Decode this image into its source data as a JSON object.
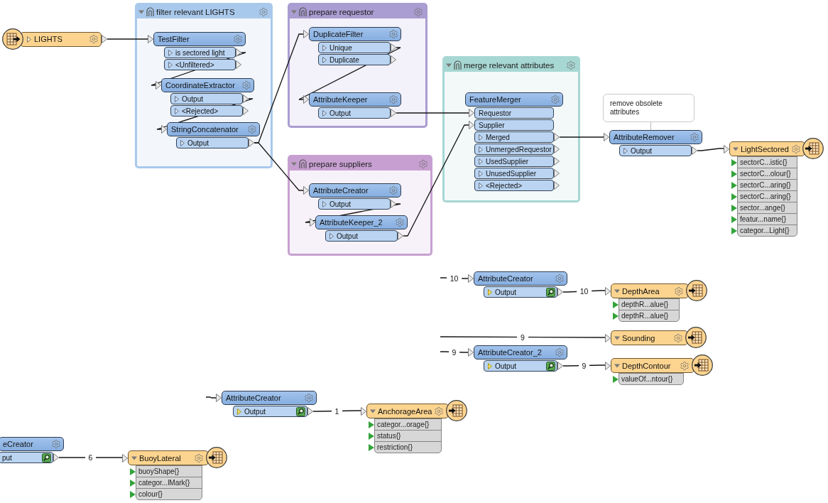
{
  "canvas": {
    "readers": [
      {
        "name": "LIGHTS",
        "expanded": false
      }
    ],
    "bookmarks": [
      {
        "title": "filter relevant LIGHTS",
        "color": "#a9c9ec",
        "expanded": true,
        "transformers": [
          {
            "name": "TestFilter",
            "outputs": [
              {
                "label": "is sectored light",
                "cached": false
              },
              {
                "label": "<Unfiltered>",
                "cached": false
              }
            ]
          },
          {
            "name": "CoordinateExtractor",
            "outputs": [
              {
                "label": "Output",
                "cached": false
              },
              {
                "label": "<Rejected>",
                "cached": false
              }
            ]
          },
          {
            "name": "StringConcatenator",
            "outputs": [
              {
                "label": "Output",
                "cached": false
              }
            ]
          }
        ]
      },
      {
        "title": "prepare requestor",
        "color": "#a99dd1",
        "expanded": true,
        "transformers": [
          {
            "name": "DuplicateFilter",
            "outputs": [
              {
                "label": "Unique",
                "cached": false
              },
              {
                "label": "Duplicate",
                "cached": false
              }
            ]
          },
          {
            "name": "AttributeKeeper",
            "outputs": [
              {
                "label": "Output",
                "cached": false
              }
            ]
          }
        ]
      },
      {
        "title": "prepare suppliers",
        "color": "#c7a0d1",
        "expanded": true,
        "transformers": [
          {
            "name": "AttributeCreator",
            "outputs": [
              {
                "label": "Output",
                "cached": false
              }
            ]
          },
          {
            "name": "AttributeKeeper_2",
            "outputs": [
              {
                "label": "Output",
                "cached": false
              }
            ]
          }
        ]
      },
      {
        "title": "merge relevant attributes",
        "color": "#a7d7d3",
        "expanded": true,
        "transformers": [
          {
            "name": "FeatureMerger",
            "inputs": [
              {
                "label": "Requestor"
              },
              {
                "label": "Supplier"
              }
            ],
            "outputs": [
              {
                "label": "Merged",
                "cached": false
              },
              {
                "label": "UnmergedRequestor",
                "cached": false
              },
              {
                "label": "UsedSupplier",
                "cached": false
              },
              {
                "label": "UnusedSupplier",
                "cached": false
              },
              {
                "label": "<Rejected>",
                "cached": false
              }
            ]
          }
        ]
      }
    ],
    "annotations": [
      {
        "text": "remove obsolete attributes"
      }
    ],
    "transformers": [
      {
        "name": "AttributeRemover",
        "outputs": [
          {
            "label": "Output",
            "cached": false
          }
        ]
      },
      {
        "name": "AttributeCreator",
        "outputs": [
          {
            "label": "Output",
            "cached": true
          }
        ]
      },
      {
        "name": "AttributeCreator_2",
        "outputs": [
          {
            "label": "Output",
            "cached": true
          }
        ]
      },
      {
        "name": "AttributeCreator",
        "outputs": [
          {
            "label": "Output",
            "cached": true
          }
        ]
      },
      {
        "name": "eCreator",
        "outputs": [
          {
            "label": "put",
            "cached": true
          }
        ]
      }
    ],
    "writers": [
      {
        "name": "LightSectored",
        "expanded": true,
        "attributes": [
          "sectorC...istic{}",
          "sectorC...olour{}",
          "sectorC...aring{}",
          "sectorC...aring{}",
          "sector...ange{}",
          "featur...name{}",
          "categor...Light{}"
        ]
      },
      {
        "name": "DepthArea",
        "expanded": true,
        "attributes": [
          "depthR...alue{}",
          "depthR...alue{}"
        ]
      },
      {
        "name": "Sounding",
        "expanded": true
      },
      {
        "name": "DepthContour",
        "expanded": true,
        "attributes": [
          "valueOf...ntour{}"
        ]
      },
      {
        "name": "AnchorageArea",
        "expanded": true,
        "attributes": [
          "categor...orage{}",
          "status{}",
          "restriction{}"
        ]
      },
      {
        "name": "BuoyLateral",
        "expanded": true,
        "attributes": [
          "buoyShape{}",
          "categor...lMark{}",
          "colour{}"
        ]
      }
    ],
    "connections": [
      {
        "count": "10"
      },
      {
        "count": "10"
      },
      {
        "count": "9"
      },
      {
        "count": "9"
      },
      {
        "count": "9"
      },
      {
        "count": "1"
      },
      {
        "count": "6"
      }
    ]
  }
}
